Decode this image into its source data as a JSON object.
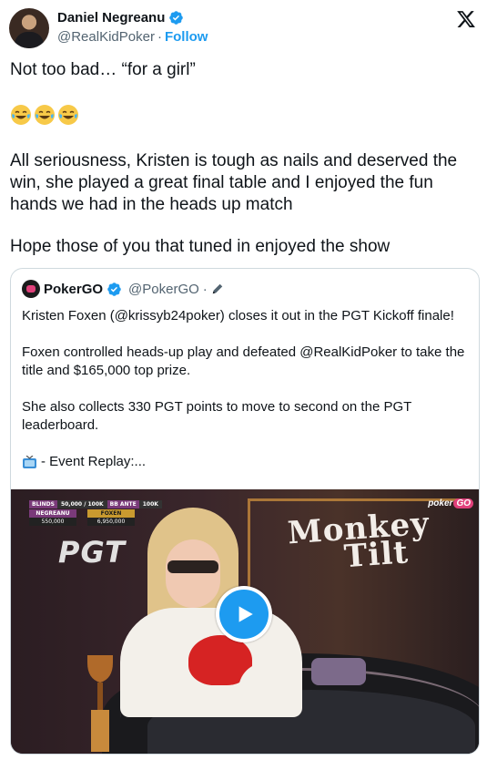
{
  "author": {
    "name": "Daniel Negreanu",
    "handle": "@RealKidPoker",
    "separator": "·",
    "follow_label": "Follow"
  },
  "tweet": {
    "line1": "Not too bad… “for a girl”",
    "emojis": [
      "face-with-tears-of-joy",
      "face-with-tears-of-joy",
      "face-with-tears-of-joy"
    ],
    "para2": "All seriousness, Kristen is tough as nails and deserved the win, she played a great final table and I enjoyed the fun hands we had in the heads up match",
    "para3": "Hope those of you that tuned in enjoyed the show"
  },
  "quote": {
    "name": "PokerGO",
    "handle": "@PokerGO",
    "separator": "·",
    "p1": "Kristen Foxen (@krissyb24poker) closes it out in the PGT Kickoff finale!",
    "p2": "Foxen controlled heads-up play and defeated @RealKidPoker to take the title and $165,000 top prize.",
    "p3": "She also collects 330 PGT points to move to second on the PGT leaderboard.",
    "replay": "- Event Replay:..."
  },
  "video": {
    "hud": {
      "blinds_label": "BLINDS",
      "blinds_value": "50,000 / 100K",
      "ante_label": "BB ANTE",
      "ante_value": "100K",
      "player1_name": "NEGREANU",
      "player1_stack": "550,000",
      "player2_name": "FOXEN",
      "player2_stack": "6,950,000"
    },
    "brand_badge_left": "poker",
    "brand_badge_right": "GO",
    "pgt_logo": "PGT",
    "monkey_line1": "Monkey",
    "monkey_line2": "Tilt"
  },
  "colors": {
    "link_blue": "#1d9bf0",
    "verified_blue": "#1d9bf0",
    "text_primary": "#0f1419",
    "text_secondary": "#536471",
    "border": "#cfd9de"
  }
}
